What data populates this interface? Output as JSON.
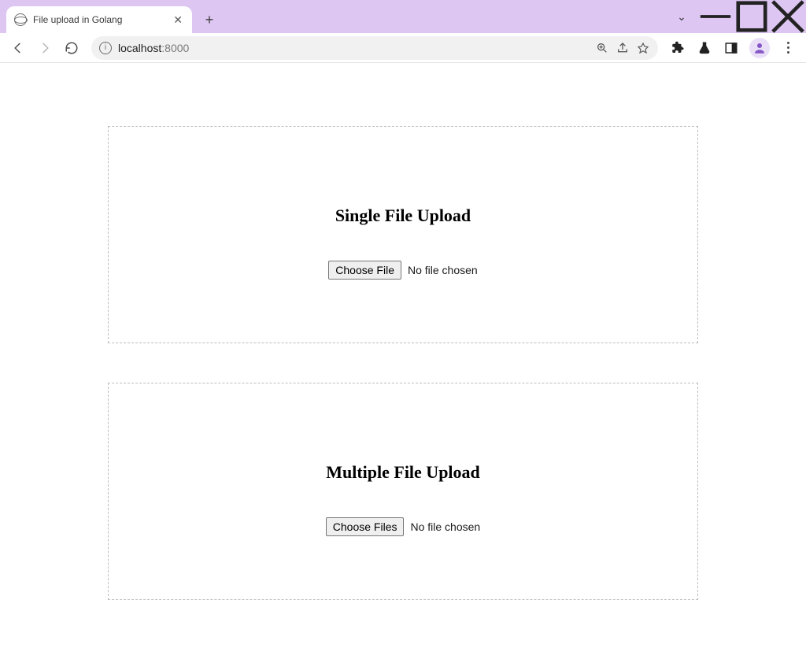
{
  "browser": {
    "tab_title": "File upload in Golang",
    "url_host": "localhost",
    "url_port": ":8000"
  },
  "page": {
    "single": {
      "heading": "Single File Upload",
      "button_label": "Choose File",
      "status": "No file chosen"
    },
    "multiple": {
      "heading": "Multiple File Upload",
      "button_label": "Choose Files",
      "status": "No file chosen"
    }
  }
}
